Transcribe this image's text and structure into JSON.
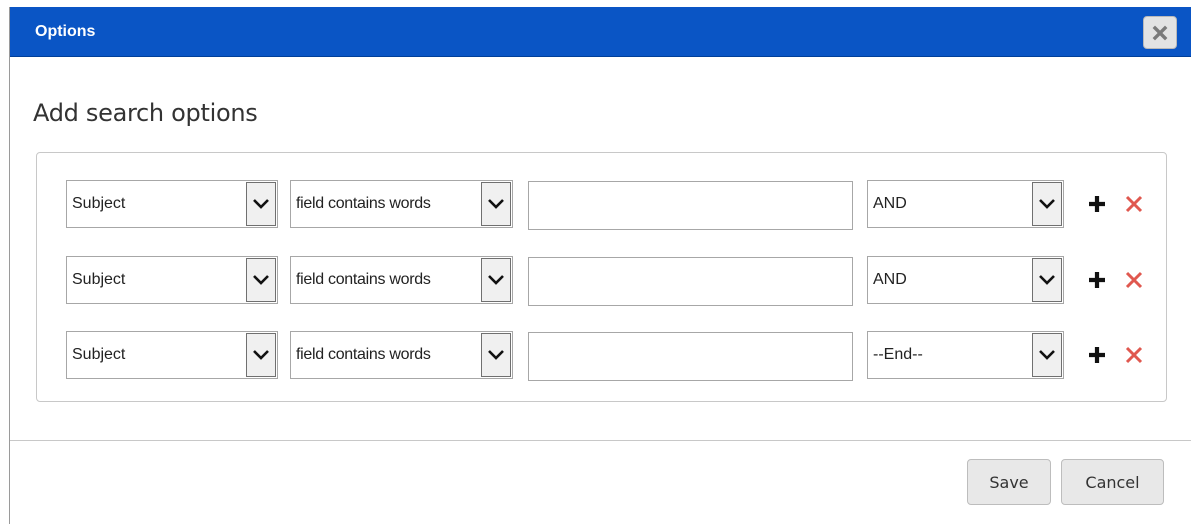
{
  "dialog": {
    "title": "Options",
    "close_icon": "close-icon",
    "heading": "Add search options"
  },
  "rows": [
    {
      "field": "Subject",
      "condition": "field contains words",
      "value": "",
      "operator": "AND"
    },
    {
      "field": "Subject",
      "condition": "field contains words",
      "value": "",
      "operator": "AND"
    },
    {
      "field": "Subject",
      "condition": "field contains words",
      "value": "",
      "operator": "--End--"
    }
  ],
  "icons": {
    "add": "plus-icon",
    "remove": "x-icon",
    "dropdown": "chevron-down-icon"
  },
  "colors": {
    "titlebar": "#0a55c5",
    "remove": "#e0584f"
  },
  "footer": {
    "save_label": "Save",
    "cancel_label": "Cancel"
  }
}
